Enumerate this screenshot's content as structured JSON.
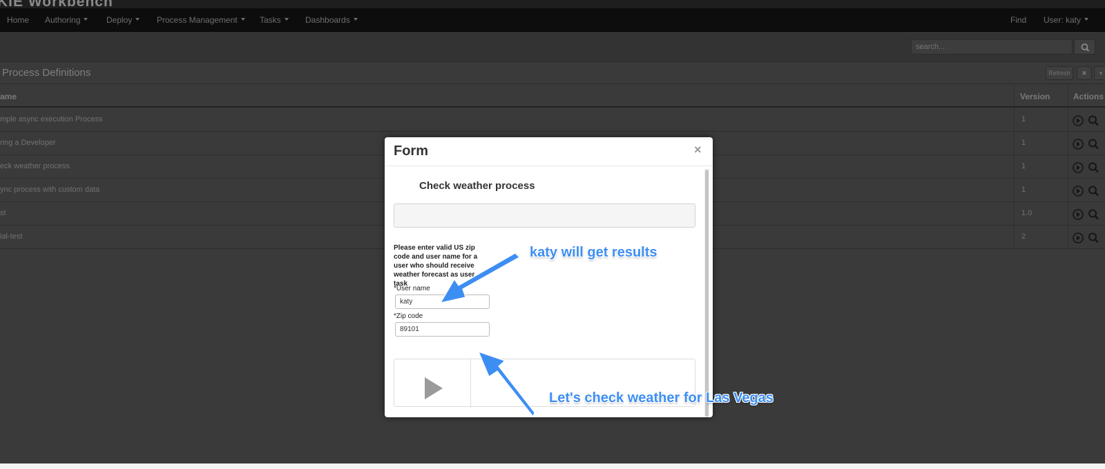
{
  "app": {
    "brand": "KIE Workbench",
    "nav": [
      "Home",
      "Authoring",
      "Deploy",
      "Process Management",
      "Tasks",
      "Dashboards"
    ],
    "nav_caret": [
      false,
      true,
      true,
      true,
      true,
      true
    ],
    "find": "Find",
    "user": "User: katy"
  },
  "search": {
    "placeholder": "search..."
  },
  "page": {
    "title": "Process Definitions",
    "refresh": "Refresh",
    "close": "✖",
    "dropdown": "▾"
  },
  "table": {
    "headers": {
      "name": "ame",
      "version": "Version",
      "actions": "Actions"
    },
    "rows": [
      {
        "name": "mple async execution Process",
        "version": "1"
      },
      {
        "name": "ring a Developer",
        "version": "1"
      },
      {
        "name": "eck weather process",
        "version": "1"
      },
      {
        "name": "ync process with custom data",
        "version": "1"
      },
      {
        "name": "st",
        "version": "1.0"
      },
      {
        "name": "ial-test",
        "version": "2"
      }
    ]
  },
  "modal": {
    "title": "Form",
    "close": "×",
    "form_title": "Check weather process",
    "instructions": "Please enter valid US zip code and user name for a user who should receive weather forecast as user task",
    "username_label": "*User name",
    "username_value": "katy",
    "zip_label": "*Zip code",
    "zip_value": "89101"
  },
  "annotations": {
    "top": "katy will get results",
    "bottom": "Let's check weather for Las Vegas",
    "color": "#3d8ef2"
  }
}
